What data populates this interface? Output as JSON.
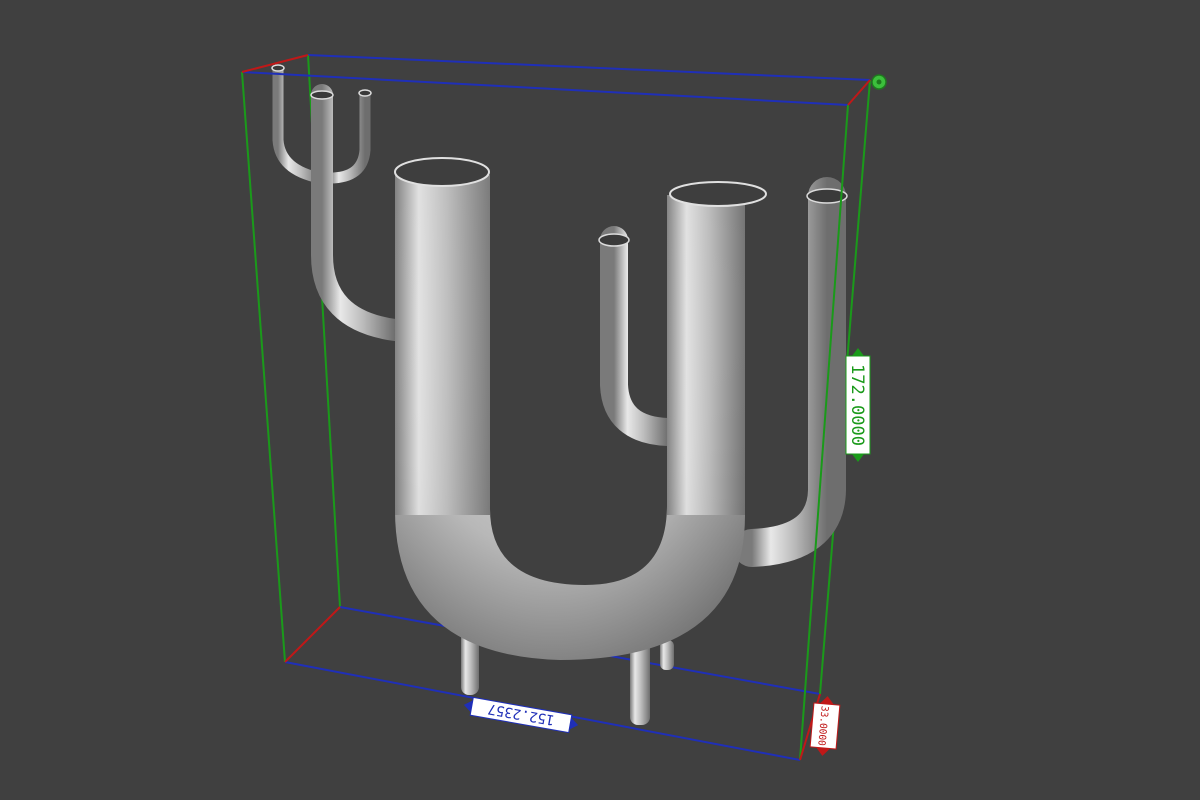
{
  "viewport": {
    "background": "#404040",
    "model_color": "#c8c8c8"
  },
  "bounding_box": {
    "x_axis_color": "#1f2fb8",
    "y_axis_color": "#c01818",
    "z_axis_color": "#1a9a1a"
  },
  "dimensions": {
    "width_label": "152.2357",
    "height_label": "172.0000",
    "depth_label": "33.0000"
  },
  "corner_handle": {
    "icon": "gear-icon",
    "color": "#3cc03c"
  }
}
